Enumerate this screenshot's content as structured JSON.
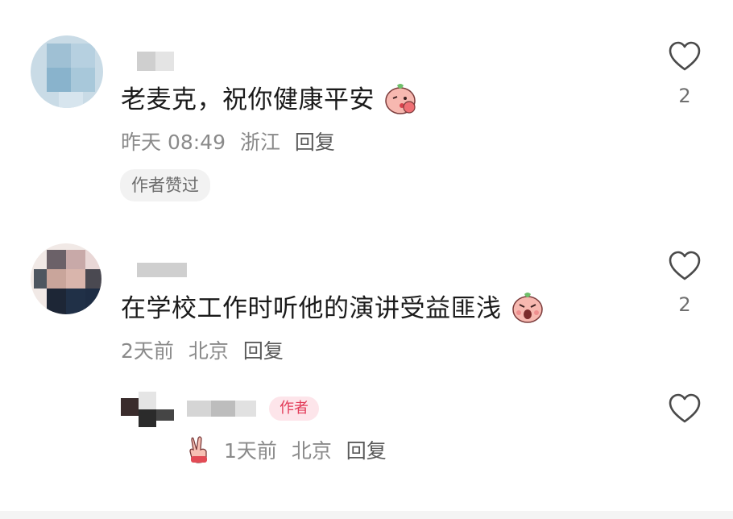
{
  "comments": [
    {
      "text": "老麦克，祝你健康平安",
      "time": "昨天 08:49",
      "location": "浙江",
      "reply_label": "回复",
      "badge": "作者赞过",
      "likes": "2"
    },
    {
      "text": "在学校工作时听他的演讲受益匪浅",
      "time": "2天前",
      "location": "北京",
      "reply_label": "回复",
      "likes": "2"
    }
  ],
  "reply": {
    "author_tag": "作者",
    "time": "1天前",
    "location": "北京",
    "reply_label": "回复",
    "likes": ""
  },
  "colors": {
    "text": "#1b1b1b",
    "meta": "#8a8a8a",
    "heart_stroke": "#4a4a4a",
    "author_tag_bg": "#fde5ea",
    "author_tag_text": "#e23b58"
  },
  "icons": [
    "heart-outline-icon",
    "kiss-emoji-icon",
    "surprised-emoji-icon",
    "victory-hand-emoji-icon"
  ]
}
